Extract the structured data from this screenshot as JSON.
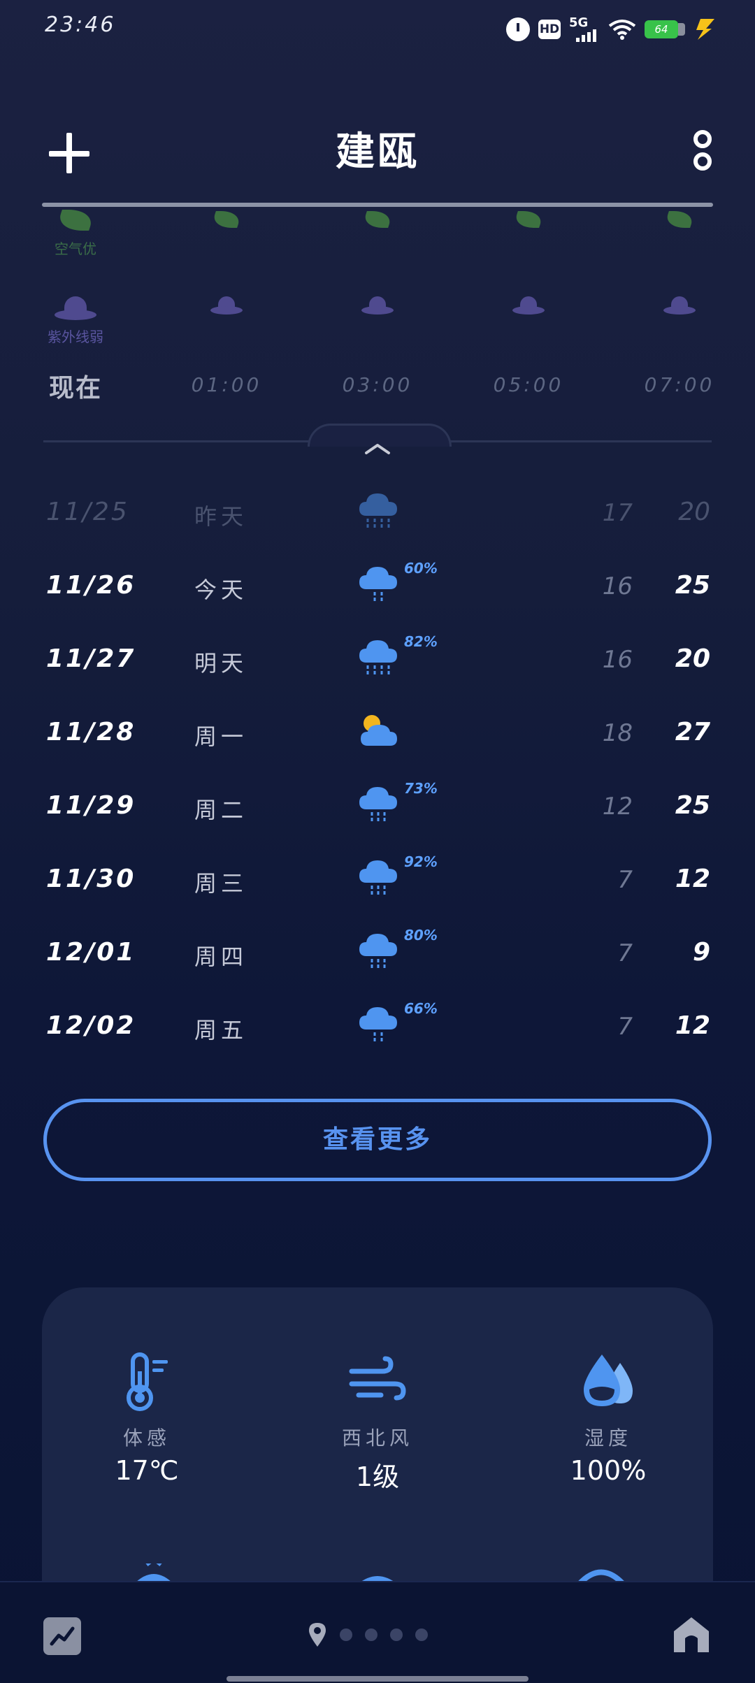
{
  "status_bar": {
    "time": "23:46",
    "network": "5G",
    "hd": "HD",
    "battery": "64"
  },
  "header": {
    "city": "建瓯"
  },
  "hourly": {
    "air_quality_label": "空气优",
    "uv_label": "紫外线弱",
    "times": [
      "现在",
      "01:00",
      "03:00",
      "05:00",
      "07:00"
    ]
  },
  "daily": [
    {
      "date": "11/25",
      "day": "昨天",
      "icon": "heavy-rain",
      "precip": "",
      "low": "17",
      "high": "20",
      "past": true
    },
    {
      "date": "11/26",
      "day": "今天",
      "icon": "light-rain",
      "precip": "60%",
      "low": "16",
      "high": "25",
      "past": false
    },
    {
      "date": "11/27",
      "day": "明天",
      "icon": "heavy-rain",
      "precip": "82%",
      "low": "16",
      "high": "20",
      "past": false
    },
    {
      "date": "11/28",
      "day": "周一",
      "icon": "partly-cloudy",
      "precip": "",
      "low": "18",
      "high": "27",
      "past": false
    },
    {
      "date": "11/29",
      "day": "周二",
      "icon": "moderate-rain",
      "precip": "73%",
      "low": "12",
      "high": "25",
      "past": false
    },
    {
      "date": "11/30",
      "day": "周三",
      "icon": "moderate-rain",
      "precip": "92%",
      "low": "7",
      "high": "12",
      "past": false
    },
    {
      "date": "12/01",
      "day": "周四",
      "icon": "moderate-rain",
      "precip": "80%",
      "low": "7",
      "high": "9",
      "past": false
    },
    {
      "date": "12/02",
      "day": "周五",
      "icon": "light-rain",
      "precip": "66%",
      "low": "7",
      "high": "12",
      "past": false
    }
  ],
  "view_more_label": "查看更多",
  "details": {
    "feels_like": {
      "label": "体感",
      "value": "17℃"
    },
    "wind": {
      "label": "西北风",
      "value": "1级"
    },
    "humidity": {
      "label": "湿度",
      "value": "100%"
    }
  },
  "colors": {
    "accent": "#5893f0",
    "rain_icon": "#4f95f0",
    "background": "#151d3b"
  }
}
